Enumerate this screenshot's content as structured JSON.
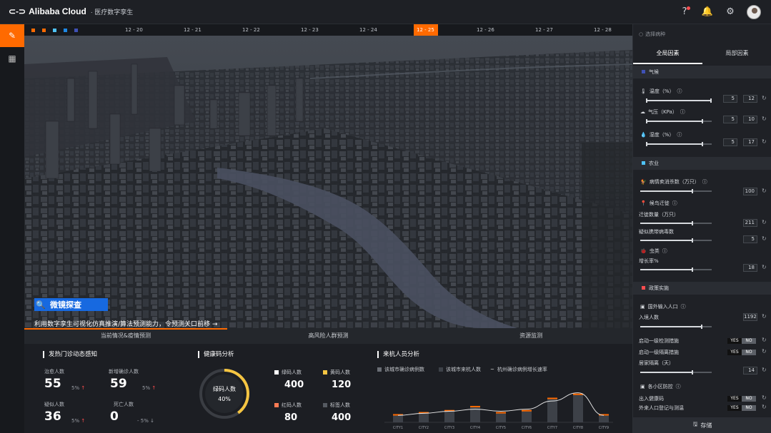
{
  "header": {
    "logo_text": "Alibaba Cloud",
    "product": "· 医疗数字孪生",
    "icons": [
      "help-icon",
      "bell-icon",
      "gear-icon",
      "avatar"
    ]
  },
  "leftnav": {
    "items": [
      "edit-icon",
      "dashboard-icon"
    ]
  },
  "timeline": {
    "swatches": [
      "#ff6a00",
      "#ff6a00",
      "#4fc3f7",
      "#1e88e5",
      "#3f51b5"
    ],
    "dates": [
      "12 - 20",
      "12 - 21",
      "12 - 22",
      "12 - 23",
      "12 - 24",
      "12 - 25",
      "12 - 26",
      "12 - 27",
      "12 - 28"
    ],
    "active": "12 - 25"
  },
  "probe": {
    "title": "微镜探查",
    "desc": "利用数字孪生可视化仿真推演/算法预测能力，令预测关口前移 →"
  },
  "tabs": [
    "当前情况&疫情预测",
    "高风险人群预测",
    "资源监测"
  ],
  "fever": {
    "title": "发热门诊动态感知",
    "stats": [
      {
        "label": "治愈人数",
        "value": "55",
        "pct": "5%",
        "dir": "↑"
      },
      {
        "label": "新增确诊人数",
        "value": "59",
        "pct": "5%",
        "dir": "↑"
      },
      {
        "label": "疑似人数",
        "value": "36",
        "pct": "5%",
        "dir": "↑"
      },
      {
        "label": "死亡人数",
        "value": "0",
        "pct": "- 5%",
        "dir": "↓"
      }
    ]
  },
  "health": {
    "title": "健康码分析",
    "donut_label": "绿码人数",
    "donut_value": "40%",
    "donut_fraction": 0.4,
    "items": [
      {
        "label": "绿码人数",
        "value": "400",
        "color": "#ffffff"
      },
      {
        "label": "黄码人数",
        "value": "120",
        "color": "#f5c542"
      },
      {
        "label": "红码人数",
        "value": "80",
        "color": "#ff7b54"
      },
      {
        "label": "标签人数",
        "value": "400",
        "color": "#555a61"
      }
    ]
  },
  "visitors": {
    "title": "来杭人员分析",
    "legend": [
      "该城市确诊病例数",
      "该城市来杭人数",
      "杭州确诊病例增长速率"
    ],
    "cities": [
      "CITY1",
      "CITY2",
      "CITY3",
      "CITY4",
      "CITY5",
      "CITY6",
      "CITY7",
      "CITY8",
      "CITY9"
    ]
  },
  "chart_data": {
    "type": "bar",
    "categories": [
      "CITY1",
      "CITY2",
      "CITY3",
      "CITY4",
      "CITY5",
      "CITY6",
      "CITY7",
      "CITY8",
      "CITY9"
    ],
    "series": [
      {
        "name": "该城市确诊病例数",
        "values": [
          3,
          4,
          5,
          7,
          4,
          5,
          10,
          12,
          3
        ]
      },
      {
        "name": "该城市来杭人数",
        "values": [
          4,
          5,
          6,
          8,
          5,
          6,
          12,
          14,
          4
        ]
      },
      {
        "name": "杭州确诊病例增长速率",
        "values": [
          2,
          3,
          4,
          5,
          4,
          5,
          9,
          13,
          2
        ]
      }
    ]
  },
  "rightpanel": {
    "search_placeholder": "选择病种",
    "tabs": [
      "全局因素",
      "局部因素"
    ],
    "weather_group": "气候",
    "temp_label": "温度（%）",
    "temp_min": "5",
    "temp_max": "12",
    "pressure_label": "气压（KPa）",
    "pressure_min": "5",
    "pressure_max": "10",
    "humidity_label": "湿度（%）",
    "humidity_min": "5",
    "humidity_max": "17",
    "farm_group": "农业",
    "farm_label": "病情卖消杀数（万只）",
    "farm_value": "100",
    "bird_label": "候鸟迁徙",
    "bird_sub1": "迁徙数量（万只）",
    "bird_val1": "211",
    "bird_sub2": "疑似携带病毒数",
    "bird_val2": "5",
    "insect_label": "虫类",
    "insect_sub": "增长率%",
    "insect_val": "18",
    "policy_group": "政策实施",
    "import_label": "国外输入人口",
    "import_sub": "入境人数",
    "import_val": "1192",
    "lvl1_detect": "启动一级检测措施",
    "lvl1_isolate": "启动一级隔离措施",
    "home_label": "居家隔离（天）",
    "home_val": "14",
    "community_label": "各小区防控",
    "code_label": "出入健康码",
    "register_label": "外来人口登记与测温",
    "yes": "YES",
    "no": "NO",
    "save": "存储"
  }
}
